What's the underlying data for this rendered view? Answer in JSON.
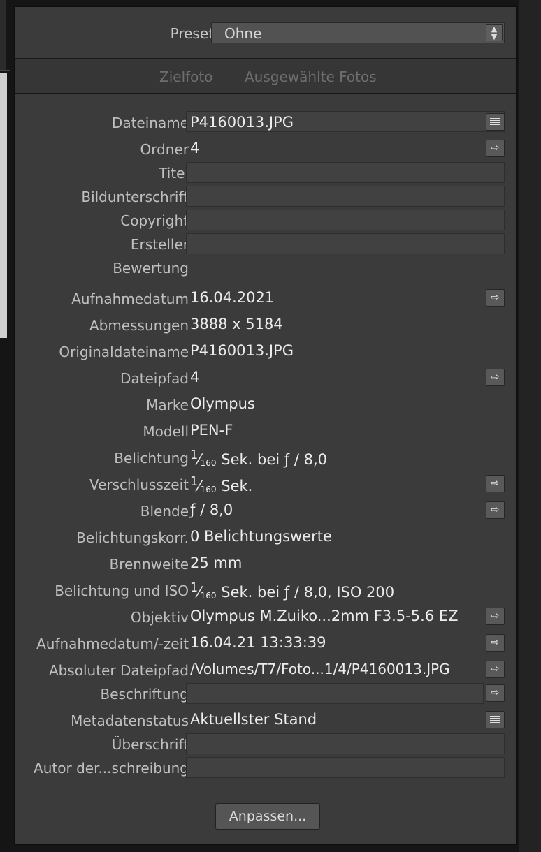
{
  "preset": {
    "label": "Preset",
    "value": "Ohne"
  },
  "tabs": [
    {
      "label": "Zielfoto"
    },
    {
      "label": "Ausgewählte Fotos"
    }
  ],
  "fields": {
    "dateiname": {
      "label": "Dateiname",
      "value": "P4160013.JPG"
    },
    "ordner": {
      "label": "Ordner",
      "value": "4"
    },
    "titel": {
      "label": "Titel",
      "value": ""
    },
    "bildunterschrift": {
      "label": "Bildunterschrift",
      "value": ""
    },
    "copyright": {
      "label": "Copyright",
      "value": ""
    },
    "ersteller": {
      "label": "Ersteller",
      "value": ""
    },
    "bewertung": {
      "label": "Bewertung",
      "value": ""
    },
    "aufnahmedatum": {
      "label": "Aufnahmedatum",
      "value": "16.04.2021"
    },
    "abmessungen": {
      "label": "Abmessungen",
      "value": "3888 x 5184"
    },
    "originaldateiname": {
      "label": "Originaldateiname",
      "value": "P4160013.JPG"
    },
    "dateipfad": {
      "label": "Dateipfad",
      "value": "4"
    },
    "marke": {
      "label": "Marke",
      "value": "Olympus"
    },
    "modell": {
      "label": "Modell",
      "value": "PEN-F"
    },
    "belichtung": {
      "label": "Belichtung",
      "value_num": "1",
      "value_den": "160",
      "value_rest": " Sek. bei ƒ / 8,0"
    },
    "verschlusszeit": {
      "label": "Verschlusszeit",
      "value_num": "1",
      "value_den": "160",
      "value_rest": " Sek."
    },
    "blende": {
      "label": "Blende",
      "value": "ƒ / 8,0"
    },
    "belichtungskorr": {
      "label": "Belichtungskorr.",
      "value": "0 Belichtungswerte"
    },
    "brennweite": {
      "label": "Brennweite",
      "value": "25 mm"
    },
    "belichtung_iso": {
      "label": "Belichtung und ISO",
      "value_num": "1",
      "value_den": "160",
      "value_rest": " Sek. bei ƒ / 8,0, ISO 200"
    },
    "objektiv": {
      "label": "Objektiv",
      "value": "Olympus M.Zuiko...2mm F3.5-5.6 EZ"
    },
    "aufnahmedatum_zeit": {
      "label": "Aufnahmedatum/-zeit",
      "value": "16.04.21 13:33:39"
    },
    "absoluter_dateipfad": {
      "label": "Absoluter Dateipfad",
      "value": "/Volumes/T7/Foto...1/4/P4160013.JPG"
    },
    "beschriftung": {
      "label": "Beschriftung",
      "value": ""
    },
    "metadatenstatus": {
      "label": "Metadatenstatus",
      "value": "Aktuellster Stand"
    },
    "ueberschrift": {
      "label": "Überschrift",
      "value": ""
    },
    "autor": {
      "label": "Autor der...schreibung",
      "value": ""
    }
  },
  "buttons": {
    "anpassen": "Anpassen..."
  },
  "icons": {
    "goto": "arrow-right-icon",
    "list": "list-icon",
    "stepper": "up-down-arrows-icon"
  }
}
